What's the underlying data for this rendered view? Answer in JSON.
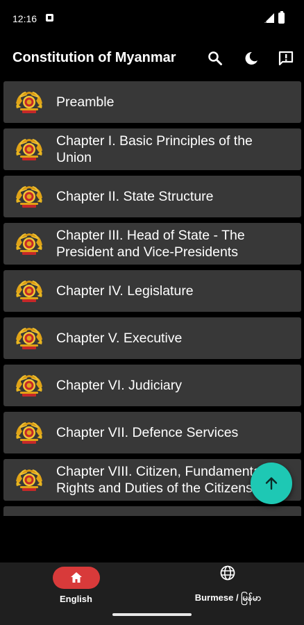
{
  "status_bar": {
    "time": "12:16"
  },
  "app_bar": {
    "title": "Constitution of Myanmar",
    "actions": [
      "search-icon",
      "dark-mode-icon",
      "feedback-icon"
    ]
  },
  "chapters": [
    {
      "label": "Preamble"
    },
    {
      "label": "Chapter I. Basic Principles of the Union"
    },
    {
      "label": "Chapter II. State Structure"
    },
    {
      "label": "Chapter III. Head of State - The President and Vice-Presidents"
    },
    {
      "label": "Chapter IV. Legislature"
    },
    {
      "label": "Chapter V. Executive"
    },
    {
      "label": "Chapter VI. Judiciary"
    },
    {
      "label": "Chapter VII. Defence Services"
    },
    {
      "label": "Chapter VIII. Citizen, Fundamental Rights and Duties of the Citizens"
    }
  ],
  "bottom_nav": {
    "items": [
      {
        "label": "English",
        "icon": "home-icon",
        "selected": true
      },
      {
        "label": "Burmese / မြန်မာ",
        "icon": "globe-icon",
        "selected": false
      }
    ]
  },
  "colors": {
    "background": "#000000",
    "card": "#383838",
    "fab": "#1ec8b4",
    "nav_selected": "#d83a3a",
    "nav_background": "#1f1f1f"
  }
}
